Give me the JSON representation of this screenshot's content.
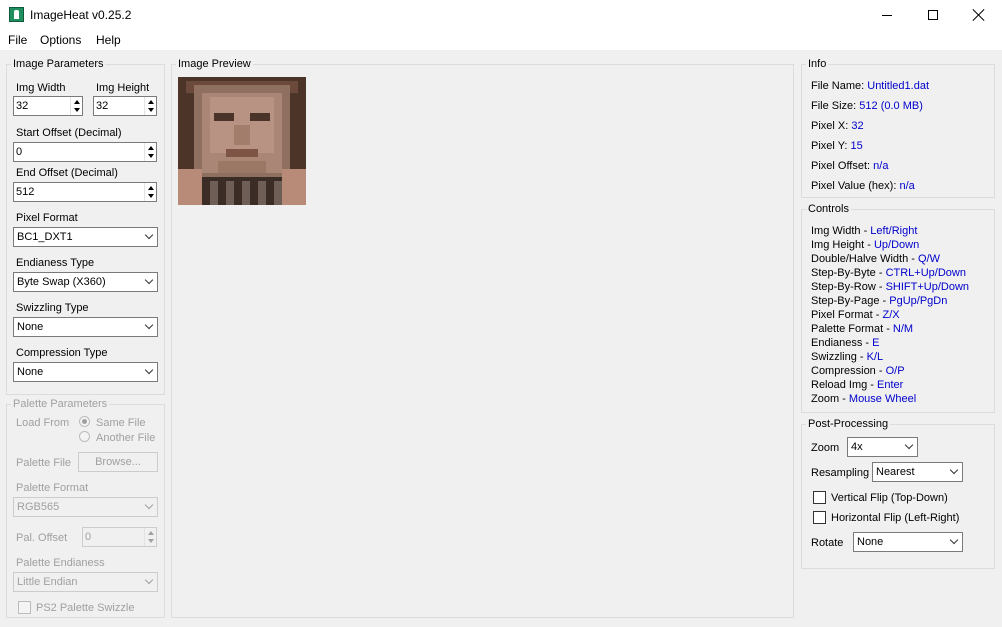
{
  "window": {
    "title": "ImageHeat v0.25.2"
  },
  "menu": [
    "File",
    "Options",
    "Help"
  ],
  "image_params": {
    "title": "Image Parameters",
    "width_label": "Img Width",
    "width_value": "32",
    "height_label": "Img Height",
    "height_value": "32",
    "start_offset_label": "Start Offset (Decimal)",
    "start_offset_value": "0",
    "end_offset_label": "End Offset (Decimal)",
    "end_offset_value": "512",
    "pixel_format_label": "Pixel Format",
    "pixel_format_value": "BC1_DXT1",
    "endianess_label": "Endianess Type",
    "endianess_value": "Byte Swap (X360)",
    "swizzling_label": "Swizzling Type",
    "swizzling_value": "None",
    "compression_label": "Compression Type",
    "compression_value": "None"
  },
  "palette_params": {
    "title": "Palette Parameters",
    "load_from_label": "Load From",
    "same_file_label": "Same File",
    "another_file_label": "Another File",
    "same_file_checked": true,
    "palette_file_label": "Palette File",
    "browse_label": "Browse...",
    "palette_format_label": "Palette Format",
    "palette_format_value": "RGB565",
    "pal_offset_label": "Pal. Offset",
    "pal_offset_value": "0",
    "palette_endianess_label": "Palette Endianess",
    "palette_endianess_value": "Little Endian",
    "ps2_swizzle_label": "PS2 Palette Swizzle",
    "ps2_swizzle_checked": false
  },
  "preview": {
    "title": "Image Preview"
  },
  "info": {
    "title": "Info",
    "rows": [
      {
        "label": "File Name: ",
        "value": "Untitled1.dat"
      },
      {
        "label": "File Size: ",
        "value": "512 (0.0 MB)"
      },
      {
        "label": "Pixel X: ",
        "value": "32"
      },
      {
        "label": "Pixel Y: ",
        "value": "15"
      },
      {
        "label": "Pixel Offset: ",
        "value": "n/a"
      },
      {
        "label": "Pixel Value (hex): ",
        "value": "n/a"
      }
    ]
  },
  "controls": {
    "title": "Controls",
    "rows": [
      {
        "label": "Img Width - ",
        "value": "Left/Right"
      },
      {
        "label": "Img Height - ",
        "value": "Up/Down"
      },
      {
        "label": "Double/Halve Width - ",
        "value": "Q/W"
      },
      {
        "label": "Step-By-Byte - ",
        "value": "CTRL+Up/Down"
      },
      {
        "label": "Step-By-Row - ",
        "value": "SHIFT+Up/Down"
      },
      {
        "label": "Step-By-Page - ",
        "value": "PgUp/PgDn"
      },
      {
        "label": "Pixel Format - ",
        "value": "Z/X"
      },
      {
        "label": "Palette Format - ",
        "value": "N/M"
      },
      {
        "label": "Endianess - ",
        "value": "E"
      },
      {
        "label": "Swizzling - ",
        "value": "K/L"
      },
      {
        "label": "Compression - ",
        "value": "O/P"
      },
      {
        "label": "Reload Img - ",
        "value": "Enter"
      },
      {
        "label": "Zoom - ",
        "value": "Mouse Wheel"
      }
    ]
  },
  "post": {
    "title": "Post-Processing",
    "zoom_label": "Zoom",
    "zoom_value": "4x",
    "resampling_label": "Resampling",
    "resampling_value": "Nearest",
    "vflip_label": "Vertical Flip (Top-Down)",
    "vflip_checked": false,
    "hflip_label": "Horizontal Flip (Left-Right)",
    "hflip_checked": false,
    "rotate_label": "Rotate",
    "rotate_value": "None"
  },
  "colors": {
    "window_bg": "#f0f0f0",
    "link_blue": "#0000cc",
    "disabled_text": "#a0a0a0"
  }
}
